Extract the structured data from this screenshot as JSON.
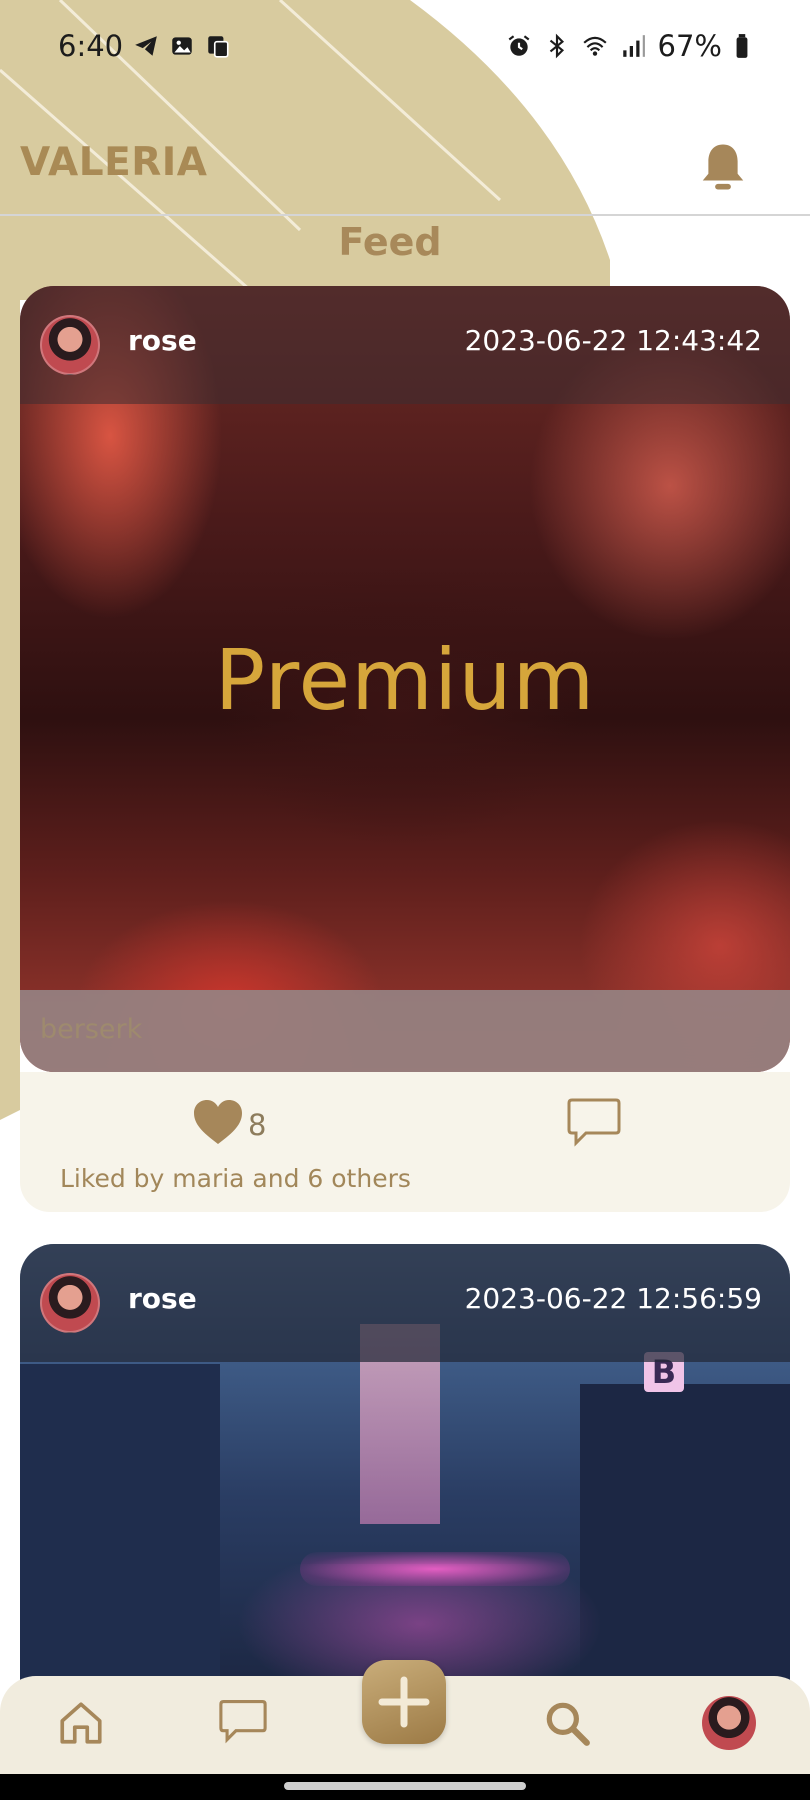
{
  "status_bar": {
    "time": "6:40",
    "battery": "67%",
    "left_icons": [
      "telegram-icon",
      "gallery-icon",
      "notification-app-icon"
    ],
    "right_icons": [
      "alarm-icon",
      "bluetooth-icon",
      "wifi-icon",
      "signal-icon",
      "battery-icon"
    ]
  },
  "header": {
    "app_name": "VALERIA",
    "notification_icon": "bell-icon"
  },
  "feed": {
    "title": "Feed"
  },
  "posts": [
    {
      "username": "rose",
      "timestamp": "2023-06-22 12:43:42",
      "overlay_text": "Premium",
      "caption": "berserk",
      "likes": "8",
      "liked_by": "Liked by maria and 6 others"
    },
    {
      "username": "rose",
      "timestamp": "2023-06-22 12:56:59",
      "sign_letter": "B"
    }
  ],
  "colors": {
    "accent": "#a98a55",
    "footer_bg": "#f7f4ea",
    "nav_bg": "#f1ecde"
  },
  "bottom_nav": {
    "items": [
      "home-icon",
      "chat-icon",
      "add-icon",
      "search-icon",
      "profile-avatar"
    ]
  }
}
